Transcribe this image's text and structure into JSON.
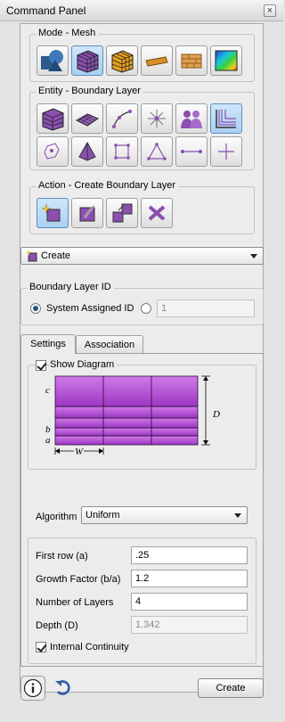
{
  "window": {
    "title": "Command Panel",
    "close_glyph": "×"
  },
  "mode": {
    "label": "Mode - Mesh",
    "buttons": [
      "geometry-mode-icon",
      "mesh-mode-icon",
      "volume-mesh-icon",
      "surface-patch-icon",
      "brick-mode-icon",
      "quality-map-icon"
    ]
  },
  "entity": {
    "label": "Entity - Boundary Layer",
    "buttons_row1": [
      "hex-mesh-icon",
      "surface-mesh-icon",
      "curve-mesh-icon",
      "vertex-star-icon",
      "group-icon",
      "boundary-layer-icon"
    ],
    "buttons_row2": [
      "hex-node-icon",
      "pyramid-icon",
      "quad-icon",
      "triangle-icon",
      "edge-icon",
      "node-cross-icon"
    ]
  },
  "action": {
    "label": "Action - Create Boundary Layer",
    "buttons": [
      "create-icon",
      "modify-icon",
      "copy-icon",
      "delete-icon"
    ]
  },
  "operation": {
    "selected": "Create"
  },
  "boundary_layer_id": {
    "label": "Boundary Layer ID",
    "system_assigned_label": "System Assigned ID",
    "id_value": "1"
  },
  "tabs": [
    {
      "label": "Settings",
      "selected": true
    },
    {
      "label": "Association",
      "selected": false
    }
  ],
  "settings": {
    "show_diagram_label": "Show Diagram",
    "diagram": {
      "c": "c",
      "b": "b",
      "a": "a",
      "D": "D",
      "W": "W"
    },
    "algorithm_label": "Algorithm",
    "algorithm_value": "Uniform",
    "first_row_label": "First row (a)",
    "first_row_value": ".25",
    "growth_factor_label": "Growth Factor (b/a)",
    "growth_factor_value": "1.2",
    "num_layers_label": "Number of Layers",
    "num_layers_value": "4",
    "depth_label": "Depth (D)",
    "depth_value": "1.342",
    "internal_continuity_label": "Internal Continuity"
  },
  "footer": {
    "create_label": "Create"
  },
  "colors": {
    "accent_purple": "#a23fc8",
    "active_button": "#a9d0f1"
  }
}
